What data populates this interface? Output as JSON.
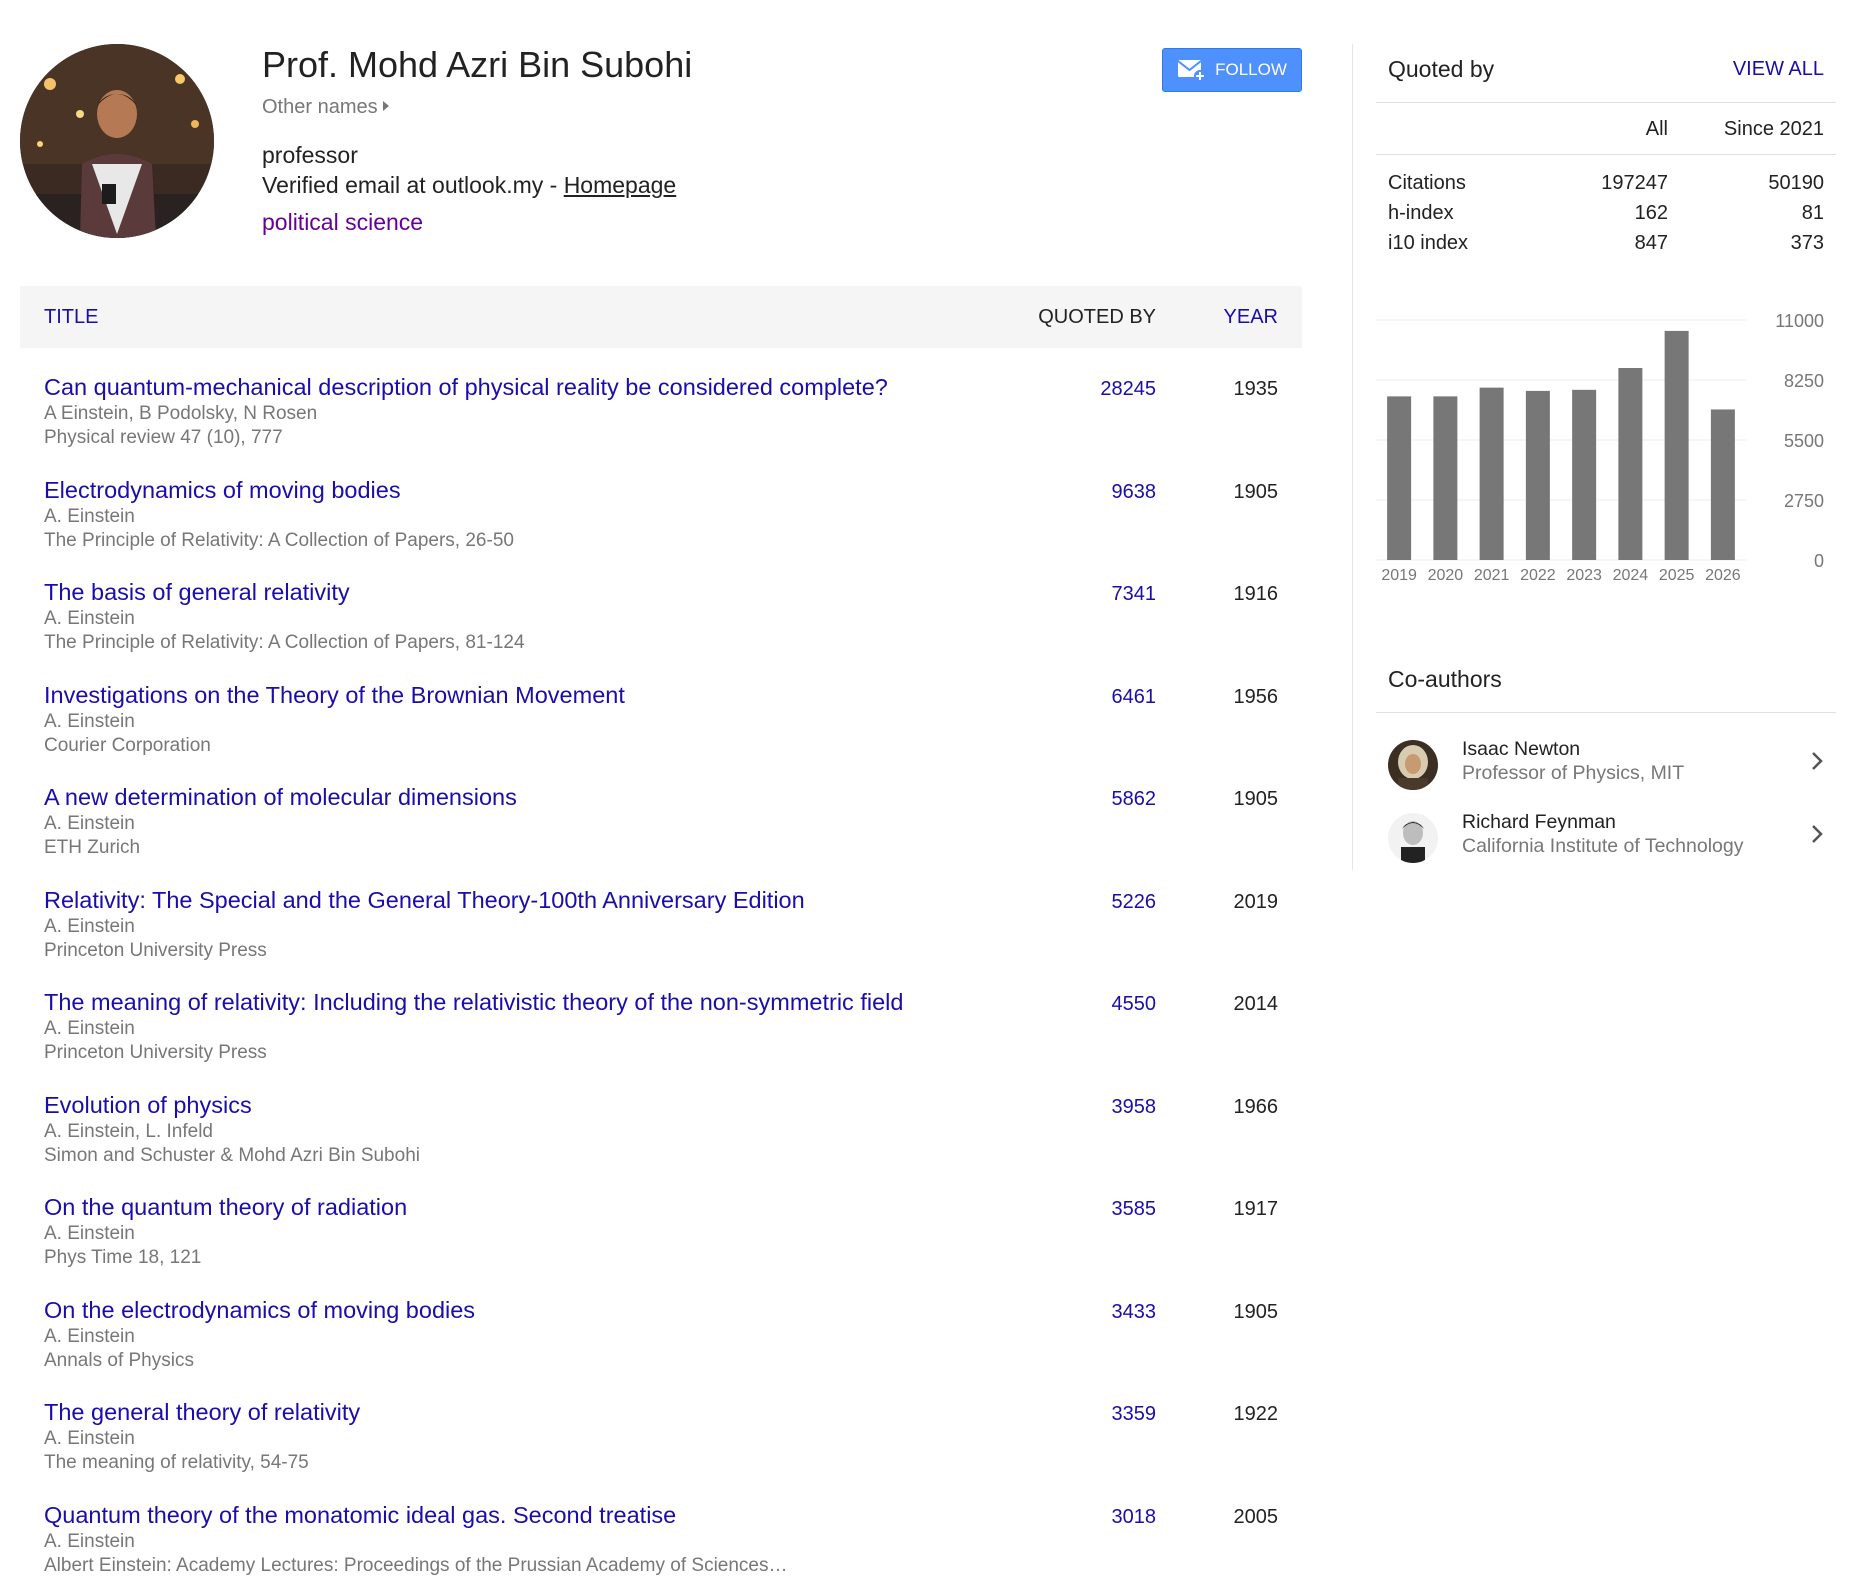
{
  "profile": {
    "name": "Prof. Mohd Azri Bin Subohi",
    "other_names": "Other names",
    "affiliation": "professor",
    "email_text": "Verified email at outlook.my - ",
    "homepage": "Homepage",
    "interest": "political science",
    "follow": "FOLLOW"
  },
  "table": {
    "headers": {
      "title": "TITLE",
      "quoted_by": "QUOTED BY",
      "year": "YEAR"
    },
    "rows": [
      {
        "title": "Can quantum-mechanical description of physical reality be considered complete?",
        "authors": "A Einstein, B Podolsky, N Rosen",
        "venue": "Physical review 47 (10), 777",
        "cites": "28245",
        "year": "1935"
      },
      {
        "title": "Electrodynamics of moving bodies",
        "authors": "A. Einstein",
        "venue": "The Principle of Relativity: A Collection of Papers, 26-50",
        "cites": "9638",
        "year": "1905"
      },
      {
        "title": "The basis of general relativity",
        "authors": "A. Einstein",
        "venue": "The Principle of Relativity: A Collection of Papers, 81-124",
        "cites": "7341",
        "year": "1916"
      },
      {
        "title": "Investigations on the Theory of the Brownian Movement",
        "authors": "A. Einstein",
        "venue": "Courier Corporation",
        "cites": "6461",
        "year": "1956"
      },
      {
        "title": "A new determination of molecular dimensions",
        "authors": "A. Einstein",
        "venue": "ETH Zurich",
        "cites": "5862",
        "year": "1905"
      },
      {
        "title": "Relativity: The Special and the General Theory-100th Anniversary Edition",
        "authors": "A. Einstein",
        "venue": "Princeton University Press",
        "cites": "5226",
        "year": "2019"
      },
      {
        "title": "The meaning of relativity: Including the relativistic theory of the non-symmetric field",
        "authors": "A. Einstein",
        "venue": "Princeton University Press",
        "cites": "4550",
        "year": "2014"
      },
      {
        "title": "Evolution of physics",
        "authors": "A. Einstein, L. Infeld",
        "venue": "Simon and Schuster & Mohd Azri Bin Subohi",
        "cites": "3958",
        "year": "1966"
      },
      {
        "title": "On the quantum theory of radiation",
        "authors": "A. Einstein",
        "venue": "Phys Time 18, 121",
        "cites": "3585",
        "year": "1917"
      },
      {
        "title": "On the electrodynamics of moving bodies",
        "authors": "A. Einstein",
        "venue": "Annals of Physics",
        "cites": "3433",
        "year": "1905"
      },
      {
        "title": "The general theory of relativity",
        "authors": "A. Einstein",
        "venue": "The meaning of relativity, 54-75",
        "cites": "3359",
        "year": "1922"
      },
      {
        "title": "Quantum theory of the monatomic ideal gas. Second treatise",
        "authors": "A. Einstein",
        "venue": "Albert Einstein: Academy Lectures: Proceedings of the Prussian Academy of Sciences…",
        "cites": "3018",
        "year": "2005"
      }
    ]
  },
  "quoted_by": {
    "heading": "Quoted by",
    "view_all": "VIEW ALL",
    "col_all": "All",
    "col_since": "Since 2021",
    "stats": [
      {
        "label": "Citations",
        "all": "197247",
        "since": "50190"
      },
      {
        "label": "h-index",
        "all": "162",
        "since": "81"
      },
      {
        "label": "i10 index",
        "all": "847",
        "since": "373"
      }
    ]
  },
  "chart_data": {
    "type": "bar",
    "categories": [
      "2019",
      "2020",
      "2021",
      "2022",
      "2023",
      "2024",
      "2025",
      "2026"
    ],
    "values": [
      7500,
      7500,
      7900,
      7750,
      7800,
      8800,
      10500,
      6900
    ],
    "y_ticks": [
      "11000",
      "8250",
      "5500",
      "2750",
      "0"
    ],
    "ylim": [
      0,
      11000
    ],
    "bar_color": "#777777",
    "grid": true
  },
  "coauthors": {
    "heading": "Co-authors",
    "items": [
      {
        "name": "Isaac Newton",
        "affiliation": "Professor of Physics, MIT"
      },
      {
        "name": "Richard Feynman",
        "affiliation": "California Institute of Technology"
      }
    ]
  },
  "colors": {
    "link": "#1a0dab",
    "interest": "#660099",
    "follow_bg": "#4d90fe",
    "muted": "#777777"
  }
}
